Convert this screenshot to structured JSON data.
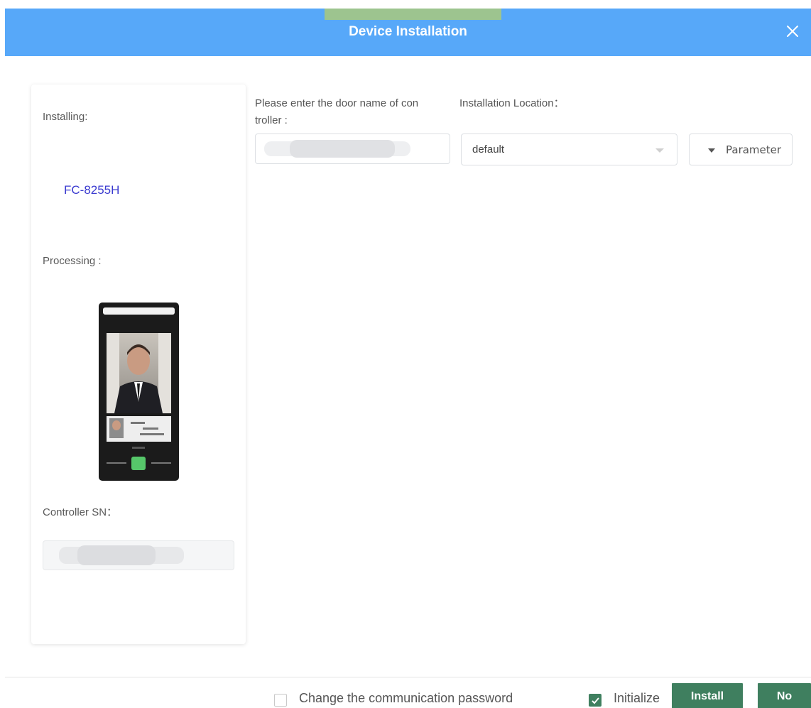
{
  "dialog": {
    "title": "Device Installation"
  },
  "left_panel": {
    "installing_label": "Installing:",
    "model_name": "FC-8255H",
    "processing_label": "Processing :",
    "controller_sn_label": "Controller SN：",
    "controller_sn_value": ""
  },
  "form": {
    "door_name_label_line1": "Please enter the door name of con",
    "door_name_label_line2": "troller :",
    "door_name_value": "",
    "location_label": "Installation Location：",
    "location_value": "default",
    "parameter_button": "Parameter"
  },
  "footer": {
    "change_password_label": "Change the communication password",
    "change_password_checked": false,
    "initialize_label": "Initialize",
    "initialize_checked": true,
    "install_button": "Install",
    "no_button": "No"
  },
  "colors": {
    "header_bg": "#57a8f9",
    "accent_green": "#9dc48f",
    "button_green": "#3f7f5f",
    "model_text": "#3a3acf"
  },
  "icons": {
    "close": "close-icon",
    "check": "check-icon",
    "dropdown": "chevron-down-icon"
  }
}
